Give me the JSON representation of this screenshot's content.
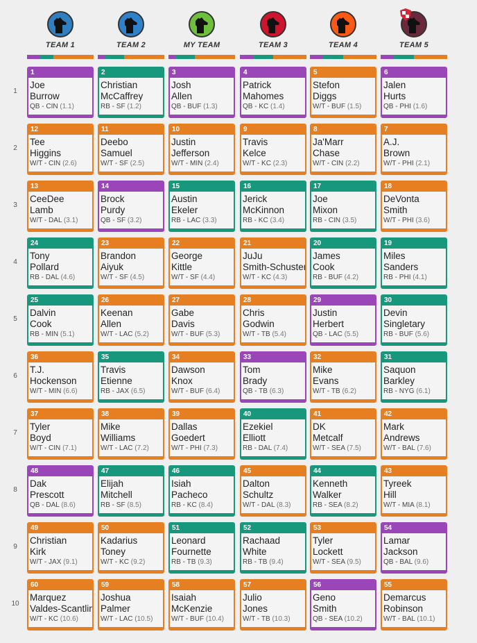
{
  "colors": {
    "QB": "#9a46b8",
    "RB": "#17977b",
    "W/T": "#e67e22"
  },
  "teams": [
    {
      "name": "TEAM 1",
      "avatar": "dog-icon",
      "avatar_color": "#2f7fc1"
    },
    {
      "name": "TEAM 2",
      "avatar": "dog-icon",
      "avatar_color": "#2f82c9"
    },
    {
      "name": "MY TEAM",
      "avatar": "dog-icon",
      "avatar_color": "#6fbf3f"
    },
    {
      "name": "TEAM 3",
      "avatar": "dog-icon",
      "avatar_color": "#d0142e"
    },
    {
      "name": "TEAM 4",
      "avatar": "dog-icon",
      "avatar_color": "#fb5a14"
    },
    {
      "name": "TEAM 5",
      "avatar": "dog-icon",
      "avatar_color": "#6b2a3c",
      "badge": "shield-icon"
    }
  ],
  "rounds": [
    {
      "label": "1",
      "picks": [
        {
          "n": "1",
          "first": "Joe",
          "last": "Burrow",
          "pos": "QB",
          "team": "CIN",
          "pick": "(1.1)"
        },
        {
          "n": "2",
          "first": "Christian",
          "last": "McCaffrey",
          "pos": "RB",
          "team": "SF",
          "pick": "(1.2)"
        },
        {
          "n": "3",
          "first": "Josh",
          "last": "Allen",
          "pos": "QB",
          "team": "BUF",
          "pick": "(1.3)"
        },
        {
          "n": "4",
          "first": "Patrick",
          "last": "Mahomes",
          "pos": "QB",
          "team": "KC",
          "pick": "(1.4)"
        },
        {
          "n": "5",
          "first": "Stefon",
          "last": "Diggs",
          "pos": "W/T",
          "team": "BUF",
          "pick": "(1.5)"
        },
        {
          "n": "6",
          "first": "Jalen",
          "last": "Hurts",
          "pos": "QB",
          "team": "PHI",
          "pick": "(1.6)"
        }
      ]
    },
    {
      "label": "2",
      "picks": [
        {
          "n": "12",
          "first": "Tee",
          "last": "Higgins",
          "pos": "W/T",
          "team": "CIN",
          "pick": "(2.6)"
        },
        {
          "n": "11",
          "first": "Deebo",
          "last": "Samuel",
          "pos": "W/T",
          "team": "SF",
          "pick": "(2.5)"
        },
        {
          "n": "10",
          "first": "Justin",
          "last": "Jefferson",
          "pos": "W/T",
          "team": "MIN",
          "pick": "(2.4)"
        },
        {
          "n": "9",
          "first": "Travis",
          "last": "Kelce",
          "pos": "W/T",
          "team": "KC",
          "pick": "(2.3)"
        },
        {
          "n": "8",
          "first": "Ja'Marr",
          "last": "Chase",
          "pos": "W/T",
          "team": "CIN",
          "pick": "(2.2)"
        },
        {
          "n": "7",
          "first": "A.J.",
          "last": "Brown",
          "pos": "W/T",
          "team": "PHI",
          "pick": "(2.1)"
        }
      ]
    },
    {
      "label": "3",
      "picks": [
        {
          "n": "13",
          "first": "CeeDee",
          "last": "Lamb",
          "pos": "W/T",
          "team": "DAL",
          "pick": "(3.1)"
        },
        {
          "n": "14",
          "first": "Brock",
          "last": "Purdy",
          "pos": "QB",
          "team": "SF",
          "pick": "(3.2)"
        },
        {
          "n": "15",
          "first": "Austin",
          "last": "Ekeler",
          "pos": "RB",
          "team": "LAC",
          "pick": "(3.3)"
        },
        {
          "n": "16",
          "first": "Jerick",
          "last": "McKinnon",
          "pos": "RB",
          "team": "KC",
          "pick": "(3.4)"
        },
        {
          "n": "17",
          "first": "Joe",
          "last": "Mixon",
          "pos": "RB",
          "team": "CIN",
          "pick": "(3.5)"
        },
        {
          "n": "18",
          "first": "DeVonta",
          "last": "Smith",
          "pos": "W/T",
          "team": "PHI",
          "pick": "(3.6)"
        }
      ]
    },
    {
      "label": "4",
      "picks": [
        {
          "n": "24",
          "first": "Tony",
          "last": "Pollard",
          "pos": "RB",
          "team": "DAL",
          "pick": "(4.6)"
        },
        {
          "n": "23",
          "first": "Brandon",
          "last": "Aiyuk",
          "pos": "W/T",
          "team": "SF",
          "pick": "(4.5)"
        },
        {
          "n": "22",
          "first": "George",
          "last": "Kittle",
          "pos": "W/T",
          "team": "SF",
          "pick": "(4.4)"
        },
        {
          "n": "21",
          "first": "JuJu",
          "last": "Smith-Schuster",
          "pos": "W/T",
          "team": "KC",
          "pick": "(4.3)"
        },
        {
          "n": "20",
          "first": "James",
          "last": "Cook",
          "pos": "RB",
          "team": "BUF",
          "pick": "(4.2)"
        },
        {
          "n": "19",
          "first": "Miles",
          "last": "Sanders",
          "pos": "RB",
          "team": "PHI",
          "pick": "(4.1)"
        }
      ]
    },
    {
      "label": "5",
      "picks": [
        {
          "n": "25",
          "first": "Dalvin",
          "last": "Cook",
          "pos": "RB",
          "team": "MIN",
          "pick": "(5.1)"
        },
        {
          "n": "26",
          "first": "Keenan",
          "last": "Allen",
          "pos": "W/T",
          "team": "LAC",
          "pick": "(5.2)"
        },
        {
          "n": "27",
          "first": "Gabe",
          "last": "Davis",
          "pos": "W/T",
          "team": "BUF",
          "pick": "(5.3)"
        },
        {
          "n": "28",
          "first": "Chris",
          "last": "Godwin",
          "pos": "W/T",
          "team": "TB",
          "pick": "(5.4)"
        },
        {
          "n": "29",
          "first": "Justin",
          "last": "Herbert",
          "pos": "QB",
          "team": "LAC",
          "pick": "(5.5)"
        },
        {
          "n": "30",
          "first": "Devin",
          "last": "Singletary",
          "pos": "RB",
          "team": "BUF",
          "pick": "(5.6)"
        }
      ]
    },
    {
      "label": "6",
      "picks": [
        {
          "n": "36",
          "first": "T.J.",
          "last": "Hockenson",
          "pos": "W/T",
          "team": "MIN",
          "pick": "(6.6)"
        },
        {
          "n": "35",
          "first": "Travis",
          "last": "Etienne",
          "pos": "RB",
          "team": "JAX",
          "pick": "(6.5)"
        },
        {
          "n": "34",
          "first": "Dawson",
          "last": "Knox",
          "pos": "W/T",
          "team": "BUF",
          "pick": "(6.4)"
        },
        {
          "n": "33",
          "first": "Tom",
          "last": "Brady",
          "pos": "QB",
          "team": "TB",
          "pick": "(6.3)"
        },
        {
          "n": "32",
          "first": "Mike",
          "last": "Evans",
          "pos": "W/T",
          "team": "TB",
          "pick": "(6.2)"
        },
        {
          "n": "31",
          "first": "Saquon",
          "last": "Barkley",
          "pos": "RB",
          "team": "NYG",
          "pick": "(6.1)"
        }
      ]
    },
    {
      "label": "7",
      "picks": [
        {
          "n": "37",
          "first": "Tyler",
          "last": "Boyd",
          "pos": "W/T",
          "team": "CIN",
          "pick": "(7.1)"
        },
        {
          "n": "38",
          "first": "Mike",
          "last": "Williams",
          "pos": "W/T",
          "team": "LAC",
          "pick": "(7.2)"
        },
        {
          "n": "39",
          "first": "Dallas",
          "last": "Goedert",
          "pos": "W/T",
          "team": "PHI",
          "pick": "(7.3)"
        },
        {
          "n": "40",
          "first": "Ezekiel",
          "last": "Elliott",
          "pos": "RB",
          "team": "DAL",
          "pick": "(7.4)"
        },
        {
          "n": "41",
          "first": "DK",
          "last": "Metcalf",
          "pos": "W/T",
          "team": "SEA",
          "pick": "(7.5)"
        },
        {
          "n": "42",
          "first": "Mark",
          "last": "Andrews",
          "pos": "W/T",
          "team": "BAL",
          "pick": "(7.6)"
        }
      ]
    },
    {
      "label": "8",
      "picks": [
        {
          "n": "48",
          "first": "Dak",
          "last": "Prescott",
          "pos": "QB",
          "team": "DAL",
          "pick": "(8.6)"
        },
        {
          "n": "47",
          "first": "Elijah",
          "last": "Mitchell",
          "pos": "RB",
          "team": "SF",
          "pick": "(8.5)"
        },
        {
          "n": "46",
          "first": "Isiah",
          "last": "Pacheco",
          "pos": "RB",
          "team": "KC",
          "pick": "(8.4)"
        },
        {
          "n": "45",
          "first": "Dalton",
          "last": "Schultz",
          "pos": "W/T",
          "team": "DAL",
          "pick": "(8.3)"
        },
        {
          "n": "44",
          "first": "Kenneth",
          "last": "Walker",
          "pos": "RB",
          "team": "SEA",
          "pick": "(8.2)"
        },
        {
          "n": "43",
          "first": "Tyreek",
          "last": "Hill",
          "pos": "W/T",
          "team": "MIA",
          "pick": "(8.1)"
        }
      ]
    },
    {
      "label": "9",
      "picks": [
        {
          "n": "49",
          "first": "Christian",
          "last": "Kirk",
          "pos": "W/T",
          "team": "JAX",
          "pick": "(9.1)"
        },
        {
          "n": "50",
          "first": "Kadarius",
          "last": "Toney",
          "pos": "W/T",
          "team": "KC",
          "pick": "(9.2)"
        },
        {
          "n": "51",
          "first": "Leonard",
          "last": "Fournette",
          "pos": "RB",
          "team": "TB",
          "pick": "(9.3)"
        },
        {
          "n": "52",
          "first": "Rachaad",
          "last": "White",
          "pos": "RB",
          "team": "TB",
          "pick": "(9.4)"
        },
        {
          "n": "53",
          "first": "Tyler",
          "last": "Lockett",
          "pos": "W/T",
          "team": "SEA",
          "pick": "(9.5)"
        },
        {
          "n": "54",
          "first": "Lamar",
          "last": "Jackson",
          "pos": "QB",
          "team": "BAL",
          "pick": "(9.6)"
        }
      ]
    },
    {
      "label": "10",
      "picks": [
        {
          "n": "60",
          "first": "Marquez",
          "last": "Valdes-Scantling",
          "pos": "W/T",
          "team": "KC",
          "pick": "(10.6)"
        },
        {
          "n": "59",
          "first": "Joshua",
          "last": "Palmer",
          "pos": "W/T",
          "team": "LAC",
          "pick": "(10.5)"
        },
        {
          "n": "58",
          "first": "Isaiah",
          "last": "McKenzie",
          "pos": "W/T",
          "team": "BUF",
          "pick": "(10.4)"
        },
        {
          "n": "57",
          "first": "Julio",
          "last": "Jones",
          "pos": "W/T",
          "team": "TB",
          "pick": "(10.3)"
        },
        {
          "n": "56",
          "first": "Geno",
          "last": "Smith",
          "pos": "QB",
          "team": "SEA",
          "pick": "(10.2)"
        },
        {
          "n": "55",
          "first": "Demarcus",
          "last": "Robinson",
          "pos": "W/T",
          "team": "BAL",
          "pick": "(10.1)"
        }
      ]
    }
  ]
}
